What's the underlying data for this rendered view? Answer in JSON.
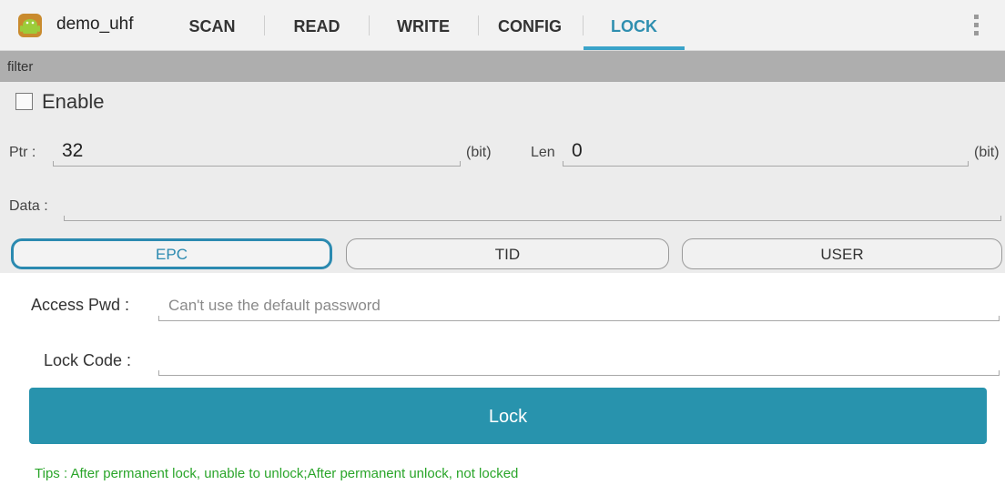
{
  "app": {
    "title": "demo_uhf",
    "icon": "android-icon"
  },
  "tabs": [
    {
      "label": "SCAN",
      "active": false
    },
    {
      "label": "READ",
      "active": false
    },
    {
      "label": "WRITE",
      "active": false
    },
    {
      "label": "CONFIG",
      "active": false
    },
    {
      "label": "LOCK",
      "active": true
    }
  ],
  "filter": {
    "header": "filter",
    "enable_label": "Enable",
    "enable_checked": false,
    "ptr_label": "Ptr :",
    "ptr_value": "32",
    "ptr_unit": "(bit)",
    "len_label": "Len",
    "len_value": "0",
    "len_unit": "(bit)",
    "data_label": "Data :",
    "data_value": "",
    "banks": [
      {
        "label": "EPC",
        "selected": true
      },
      {
        "label": "TID",
        "selected": false
      },
      {
        "label": "USER",
        "selected": false
      }
    ]
  },
  "lock": {
    "access_pwd_label": "Access Pwd :",
    "access_pwd_placeholder": "Can't use the default password",
    "lock_code_label": "Lock Code :",
    "lock_code_value": "",
    "button_label": "Lock",
    "tips": "Tips : After permanent lock, unable to unlock;After permanent unlock, not locked"
  },
  "colors": {
    "accent": "#2893ad",
    "tab_active": "#2f8fb0",
    "tips": "#2aa52a",
    "filter_header": "#aeaeae"
  }
}
